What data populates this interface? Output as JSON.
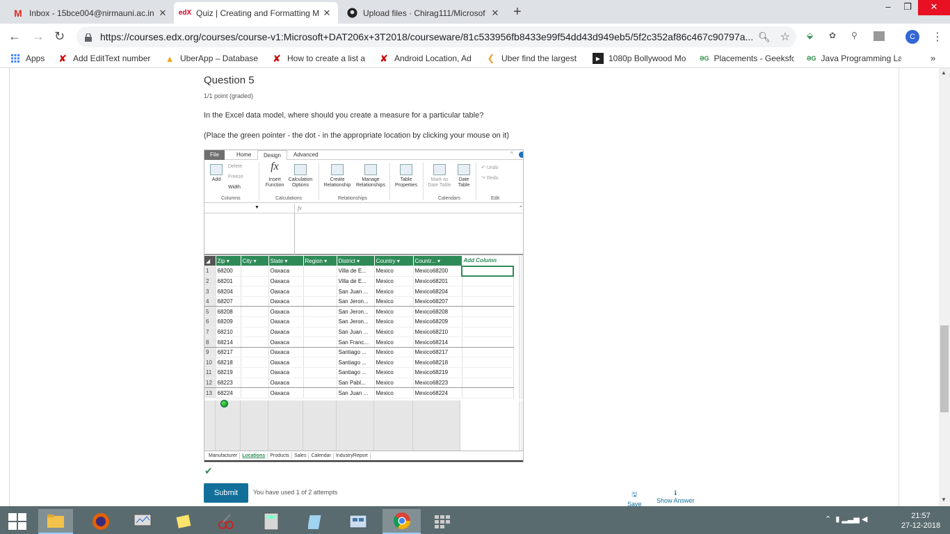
{
  "browser": {
    "tabs": [
      {
        "title": "Inbox - 15bce004@nirmauni.ac.in",
        "icon": "gmail-icon",
        "active": false
      },
      {
        "title": "Quiz | Creating and Formatting M",
        "icon": "edx-icon",
        "active": true
      },
      {
        "title": "Upload files · Chirag111/Microsof",
        "icon": "github-icon",
        "active": false
      }
    ],
    "url": "https://courses.edx.org/courses/course-v1:Microsoft+DAT206x+3T2018/courseware/81c533956fb8433e99f54dd43d949eb5/5f2c352af86c467c90797a...",
    "profile_initial": "C",
    "bookmarks": [
      {
        "label": "Apps",
        "icon": "apps-grid-icon"
      },
      {
        "label": "Add EditText number",
        "icon": "x-mark-icon"
      },
      {
        "label": "UberApp – Database",
        "icon": "firebase-icon"
      },
      {
        "label": "How to create a list a",
        "icon": "x-mark-icon"
      },
      {
        "label": "Android Location, Ad",
        "icon": "x-mark-icon"
      },
      {
        "label": "Uber find the largest",
        "icon": "leetcode-icon"
      },
      {
        "label": "1080p Bollywood Mo",
        "icon": "play-icon"
      },
      {
        "label": "Placements - Geeksfo",
        "icon": "geeksforgeeks-icon"
      },
      {
        "label": "Java Programming La",
        "icon": "geeksforgeeks-icon"
      }
    ],
    "more_bookmarks": "»"
  },
  "question": {
    "title": "Question 5",
    "points": "1/1 point (graded)",
    "text": "In the Excel data model, where should you create a measure for a particular table?",
    "instruction": "(Place the green pointer - the dot - in the appropriate location by clicking your mouse on it)"
  },
  "excel": {
    "ribbon_tabs": [
      "File",
      "Home",
      "Design",
      "Advanced"
    ],
    "active_tab": "Design",
    "buttons": {
      "add": "Add",
      "delete": "Delete",
      "freeze": "Freeze",
      "width": "Width",
      "insert_function": "Insert\nFunction",
      "calculation_options": "Calculation\nOptions",
      "create_relationship": "Create\nRelationship",
      "manage_relationships": "Manage\nRelationships",
      "table_properties": "Table\nProperties",
      "mark_as_date_table": "Mark as\nDate Table",
      "date_table": "Date\nTable",
      "undo": "Undo",
      "redo": "Redo"
    },
    "groups": [
      "Columns",
      "Calculations",
      "Relationships",
      "Calendars",
      "Edit"
    ],
    "fx": "fx",
    "columns": [
      "Zip",
      "City",
      "State",
      "Region",
      "District",
      "Country",
      "Countr...",
      "Add Column"
    ],
    "rows": [
      [
        "1",
        "68200",
        "",
        "Oaxaca",
        "",
        "Villa de E...",
        "Mexico",
        "Mexico68200"
      ],
      [
        "2",
        "68201",
        "",
        "Oaxaca",
        "",
        "Villa de E...",
        "Mexico",
        "Mexico68201"
      ],
      [
        "3",
        "68204",
        "",
        "Oaxaca",
        "",
        "San Juan ...",
        "Mexico",
        "Mexico68204"
      ],
      [
        "4",
        "68207",
        "",
        "Oaxaca",
        "",
        "San Jeron...",
        "Mexico",
        "Mexico68207"
      ],
      [
        "5",
        "68208",
        "",
        "Oaxaca",
        "",
        "San Jeron...",
        "Mexico",
        "Mexico68208"
      ],
      [
        "6",
        "68209",
        "",
        "Oaxaca",
        "",
        "San Jeron...",
        "Mexico",
        "Mexico68209"
      ],
      [
        "7",
        "68210",
        "",
        "Oaxaca",
        "",
        "San Juan ...",
        "Mexico",
        "Mexico68210"
      ],
      [
        "8",
        "68214",
        "",
        "Oaxaca",
        "",
        "San Franc...",
        "Mexico",
        "Mexico68214"
      ],
      [
        "9",
        "68217",
        "",
        "Oaxaca",
        "",
        "Santiago ...",
        "Mexico",
        "Mexico68217"
      ],
      [
        "10",
        "68218",
        "",
        "Oaxaca",
        "",
        "Santiago ...",
        "Mexico",
        "Mexico68218"
      ],
      [
        "11",
        "68219",
        "",
        "Oaxaca",
        "",
        "Santiago ...",
        "Mexico",
        "Mexico68219"
      ],
      [
        "12",
        "68223",
        "",
        "Oaxaca",
        "",
        "San Pabl...",
        "Mexico",
        "Mexico68223"
      ],
      [
        "13",
        "68224",
        "",
        "Oaxaca",
        "",
        "San Juan ...",
        "Mexico",
        "Mexico68224"
      ]
    ],
    "sheets": [
      "Manufacturer",
      "Locations",
      "Products",
      "Sales",
      "Calendar",
      "IndustryReport"
    ],
    "active_sheet": "Locations"
  },
  "actions": {
    "submit": "Submit",
    "attempts": "You have used 1 of 2 attempts",
    "save": "Save",
    "show_answer": "Show Answer"
  },
  "taskbar": {
    "time": "21:57",
    "date": "27-12-2018"
  },
  "colors": {
    "accent": "#126f9a",
    "excel_green": "#2e8b57",
    "correct": "#2e8b57"
  }
}
